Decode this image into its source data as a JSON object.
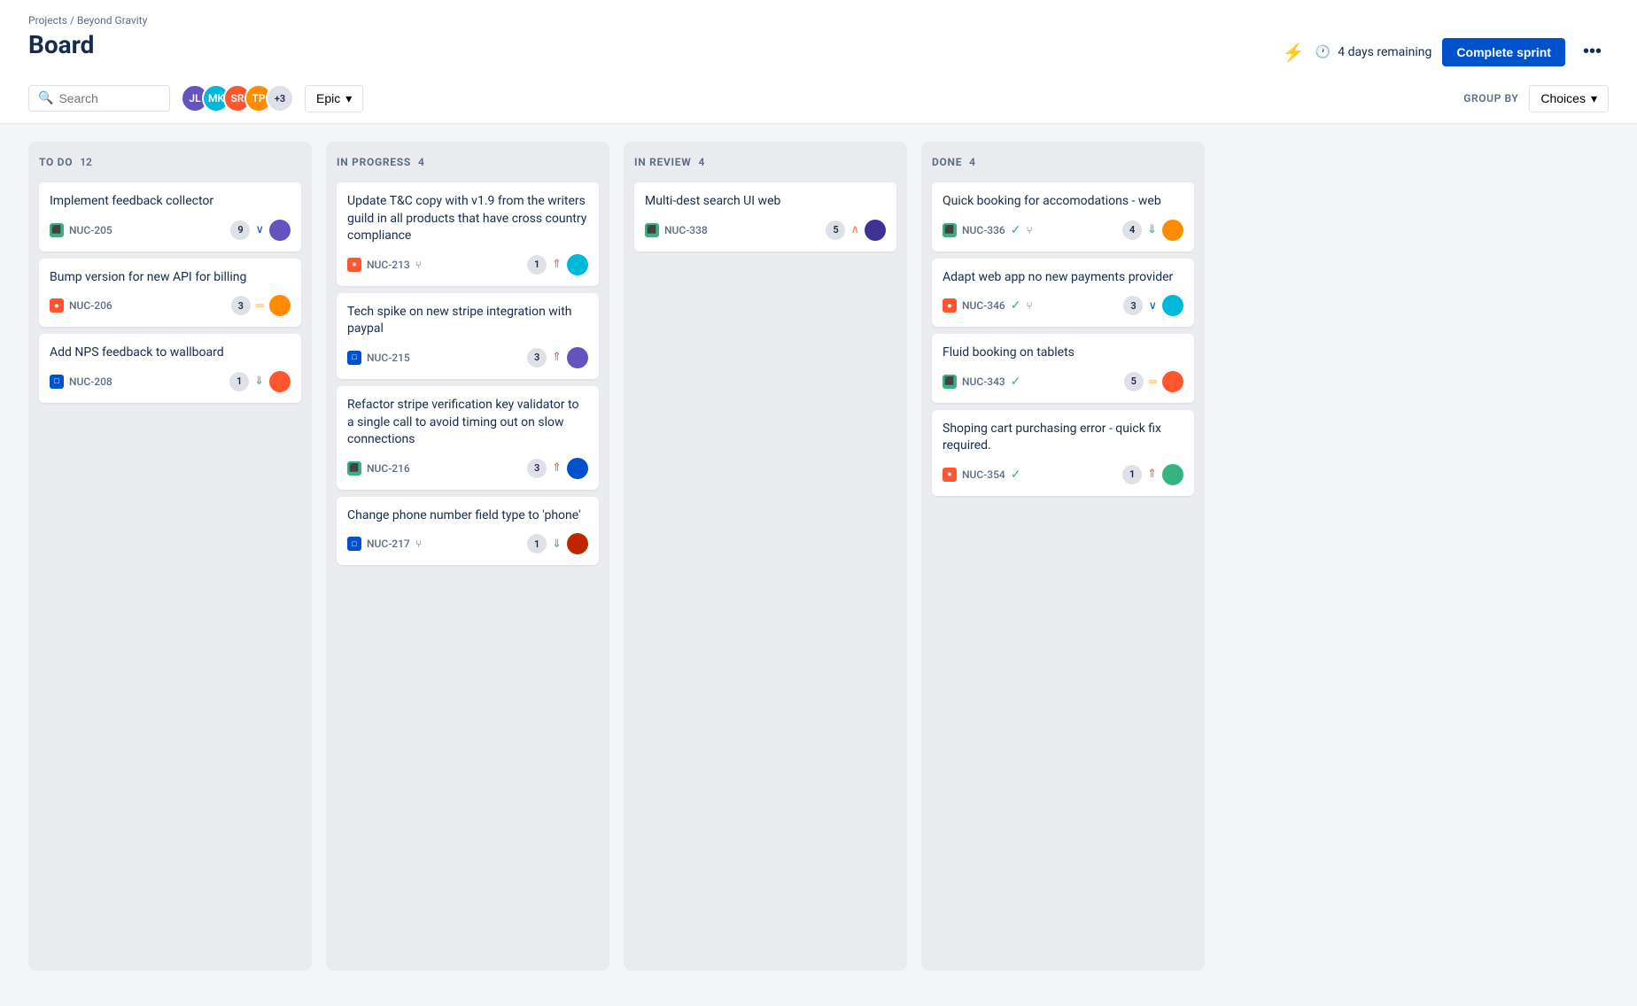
{
  "breadcrumb": "Projects / Beyond Gravity",
  "page_title": "Board",
  "sprint_remaining": "4 days remaining",
  "complete_sprint_label": "Complete sprint",
  "group_by_label": "GROUP BY",
  "choices_label": "Choices",
  "epic_label": "Epic",
  "search_placeholder": "Search",
  "more_options_label": "...",
  "columns": [
    {
      "id": "todo",
      "title": "TO DO",
      "count": 12,
      "cards": [
        {
          "id": "c1",
          "title": "Implement feedback collector",
          "issue_id": "NUC-205",
          "issue_type": "story",
          "badge": "9",
          "priority": "chevron-down",
          "priority_color": "blue",
          "avatar_color": "av1"
        },
        {
          "id": "c2",
          "title": "Bump version for new API for billing",
          "issue_id": "NUC-206",
          "issue_type": "bug",
          "badge": "3",
          "priority": "equals",
          "priority_color": "yellow",
          "avatar_color": "av2"
        },
        {
          "id": "c3",
          "title": "Add NPS feedback to wallboard",
          "issue_id": "NUC-208",
          "issue_type": "task",
          "badge": "1",
          "priority": "double-chevron-down",
          "priority_color": "green",
          "avatar_color": "av5"
        }
      ]
    },
    {
      "id": "inprogress",
      "title": "IN PROGRESS",
      "count": 4,
      "cards": [
        {
          "id": "c4",
          "title": "Update T&C copy with v1.9 from the writers guild in all products that have cross country compliance",
          "issue_id": "NUC-213",
          "issue_type": "bug",
          "badge": "1",
          "priority": "double-chevron-up",
          "priority_color": "red",
          "has_branch": true,
          "avatar_color": "av3"
        },
        {
          "id": "c5",
          "title": "Tech spike on new stripe integration with paypal",
          "issue_id": "NUC-215",
          "issue_type": "task",
          "badge": "3",
          "priority": "double-chevron-up",
          "priority_color": "red",
          "has_branch": false,
          "avatar_color": "av1"
        },
        {
          "id": "c6",
          "title": "Refactor stripe verification key validator to a single call to avoid timing out on slow connections",
          "issue_id": "NUC-216",
          "issue_type": "story",
          "badge": "3",
          "priority": "double-chevron-up",
          "priority_color": "red",
          "has_branch": false,
          "avatar_color": "av6"
        },
        {
          "id": "c7",
          "title": "Change phone number field type to 'phone'",
          "issue_id": "NUC-217",
          "issue_type": "task",
          "badge": "1",
          "priority": "double-chevron-down",
          "priority_color": "green",
          "has_branch": true,
          "avatar_color": "av7"
        }
      ]
    },
    {
      "id": "inreview",
      "title": "IN REVIEW",
      "count": 4,
      "cards": [
        {
          "id": "c8",
          "title": "Multi-dest search UI web",
          "issue_id": "NUC-338",
          "issue_type": "story",
          "badge": "5",
          "priority": "chevron-up",
          "priority_color": "orange",
          "has_branch": false,
          "avatar_color": "av8"
        }
      ]
    },
    {
      "id": "done",
      "title": "DONE",
      "count": 4,
      "cards": [
        {
          "id": "c9",
          "title": "Quick booking for accomodations - web",
          "issue_id": "NUC-336",
          "issue_type": "story",
          "badge": "4",
          "priority": "double-chevron-down",
          "priority_color": "green",
          "has_check": true,
          "has_branch": true,
          "avatar_color": "av2"
        },
        {
          "id": "c10",
          "title": "Adapt web app no new payments provider",
          "issue_id": "NUC-346",
          "issue_type": "bug",
          "badge": "3",
          "priority": "chevron-down",
          "priority_color": "blue",
          "has_check": true,
          "has_branch": true,
          "avatar_color": "av3"
        },
        {
          "id": "c11",
          "title": "Fluid booking on tablets",
          "issue_id": "NUC-343",
          "issue_type": "story",
          "badge": "5",
          "priority": "equals",
          "priority_color": "yellow",
          "has_check": true,
          "has_branch": false,
          "avatar_color": "av5"
        },
        {
          "id": "c12",
          "title": "Shoping cart purchasing error - quick fix required.",
          "issue_id": "NUC-354",
          "issue_type": "bug",
          "badge": "1",
          "priority": "double-chevron-up",
          "priority_color": "red",
          "has_check": true,
          "has_branch": false,
          "avatar_color": "av4"
        }
      ]
    }
  ]
}
